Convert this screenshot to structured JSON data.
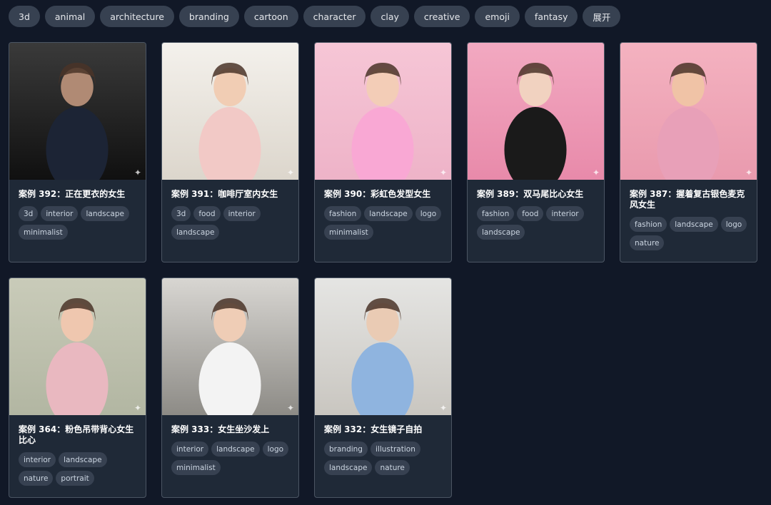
{
  "filters": [
    "3d",
    "animal",
    "architecture",
    "branding",
    "cartoon",
    "character",
    "clay",
    "creative",
    "emoji",
    "fantasy",
    "展开"
  ],
  "cards": [
    {
      "title": "案例 392：正在更衣的女生",
      "tags": [
        "3d",
        "interior",
        "landscape",
        "minimalist"
      ],
      "bg": [
        "#3a3a3a",
        "#101010"
      ],
      "figure": "#1c2435",
      "skin": "#b08a74"
    },
    {
      "title": "案例 391：咖啡厅室内女生",
      "tags": [
        "3d",
        "food",
        "interior",
        "landscape"
      ],
      "bg": [
        "#f4f1ec",
        "#dcd6cc"
      ],
      "figure": "#f2c9c6",
      "skin": "#f1cdb4"
    },
    {
      "title": "案例 390：彩虹色发型女生",
      "tags": [
        "fashion",
        "landscape",
        "logo",
        "minimalist"
      ],
      "bg": [
        "#f6c6d6",
        "#eeb3c8"
      ],
      "figure": "#f9a8d4",
      "skin": "#f3cdb7"
    },
    {
      "title": "案例 389：双马尾比心女生",
      "tags": [
        "fashion",
        "food",
        "interior",
        "landscape"
      ],
      "bg": [
        "#f2a9c1",
        "#e88aaa"
      ],
      "figure": "#1a1a1a",
      "skin": "#f1d2c0"
    },
    {
      "title": "案例 387：握着复古银色麦克风女生",
      "tags": [
        "fashion",
        "landscape",
        "logo",
        "nature"
      ],
      "bg": [
        "#f4b2c0",
        "#e99aae"
      ],
      "figure": "#e8a0b8",
      "skin": "#f0c3a6"
    },
    {
      "title": "案例 364：粉色吊带背心女生比心",
      "tags": [
        "interior",
        "landscape",
        "nature",
        "portrait"
      ],
      "bg": [
        "#c9cbb9",
        "#b2b6a2"
      ],
      "figure": "#e9b8c0",
      "skin": "#efc7af"
    },
    {
      "title": "案例 333：女生坐沙发上",
      "tags": [
        "interior",
        "landscape",
        "logo",
        "minimalist"
      ],
      "bg": [
        "#d8d6d2",
        "#8d8b86"
      ],
      "figure": "#f3f3f3",
      "skin": "#efcdb6"
    },
    {
      "title": "案例 332：女生镜子自拍",
      "tags": [
        "branding",
        "illustration",
        "landscape",
        "nature"
      ],
      "bg": [
        "#e5e5e3",
        "#c9c6c0"
      ],
      "figure": "#8fb4df",
      "skin": "#eacbb4"
    }
  ],
  "sparkle_icon": "✦"
}
